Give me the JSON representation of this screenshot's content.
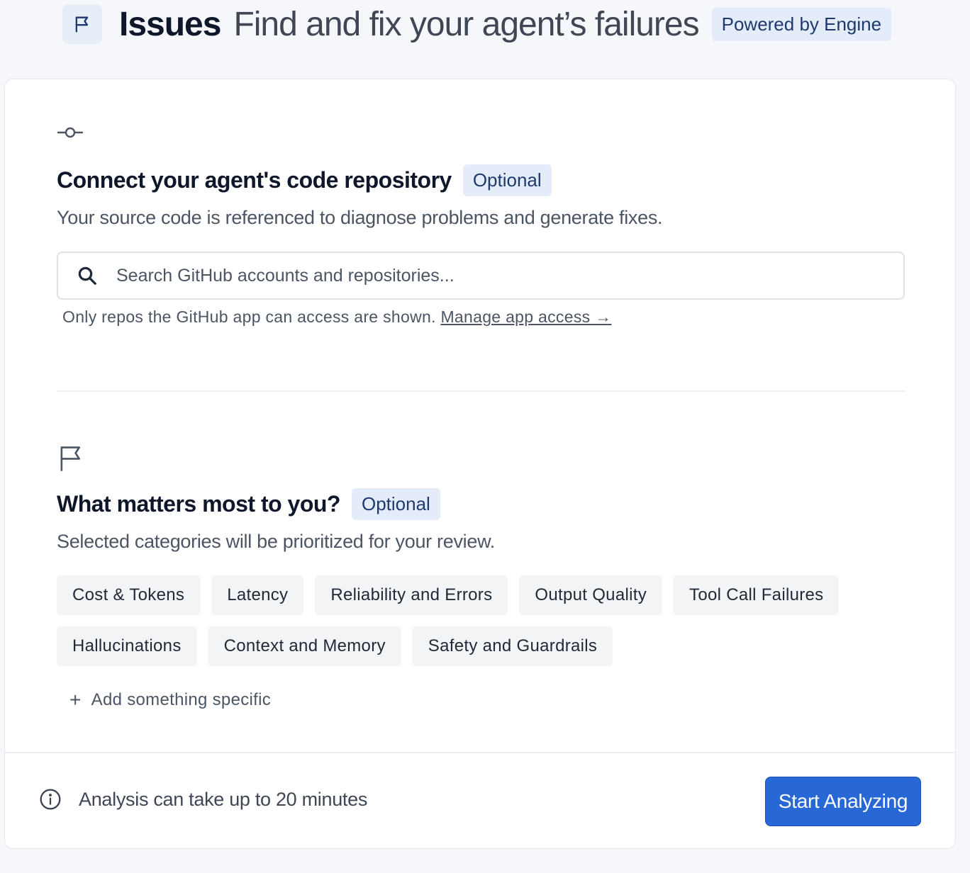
{
  "header": {
    "title": "Issues",
    "subtitle": "Find and fix your agent’s failures",
    "badge": "Powered by Engine"
  },
  "repo_section": {
    "title": "Connect your agent's code repository",
    "badge": "Optional",
    "description": "Your source code is referenced to diagnose problems and generate fixes.",
    "search_placeholder": "Search GitHub accounts and repositories...",
    "search_value": "",
    "hint_text": "Only repos the GitHub app can access are shown.",
    "hint_link": "Manage app access →"
  },
  "priorities_section": {
    "title": "What matters most to you?",
    "badge": "Optional",
    "description": "Selected categories will be prioritized for your review.",
    "chips_row1": [
      "Cost & Tokens",
      "Latency",
      "Reliability and Errors",
      "Output Quality",
      "Tool Call Failures"
    ],
    "chips_row2": [
      "Hallucinations",
      "Context and Memory",
      "Safety and Guardrails"
    ],
    "add_label": "Add something specific"
  },
  "footer": {
    "info_text": "Analysis can take up to 20 minutes",
    "start_button": "Start Analyzing"
  },
  "icons": {
    "header": "flag-icon",
    "repo": "git-commit-icon",
    "priorities": "flag-icon",
    "search": "search-icon",
    "add": "plus-icon",
    "info": "info-icon"
  },
  "colors": {
    "accent": "#2867d6",
    "badge_bg": "#e3ecf8",
    "badge_text": "#1f3a6e",
    "page_bg": "#f5f7fa"
  }
}
